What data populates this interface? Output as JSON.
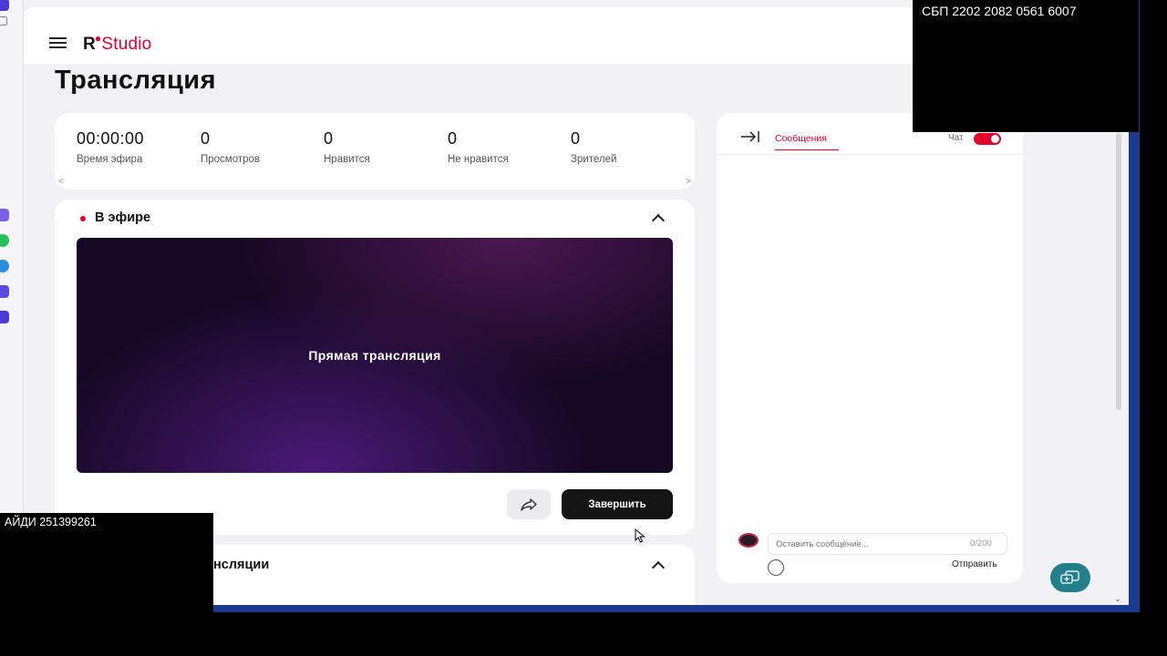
{
  "brand": {
    "r": "R",
    "studio": "Studio"
  },
  "page": {
    "title": "Трансляция"
  },
  "stats": [
    {
      "value": "00:00:00",
      "label": "Время эфира"
    },
    {
      "value": "0",
      "label": "Просмотров"
    },
    {
      "value": "0",
      "label": "Нравится"
    },
    {
      "value": "0",
      "label": "Не нравится"
    },
    {
      "value": "0",
      "label": "Зрителей"
    }
  ],
  "stats_scroll": {
    "left": "<",
    "right": ">"
  },
  "live": {
    "title": "В эфире",
    "video_label": "Прямая трансляция",
    "end_label": "Завершить"
  },
  "info_section": {
    "title": "нсляции"
  },
  "chat": {
    "tab_messages": "Сообщения",
    "toggle_label": "Чат",
    "toggle_on": true,
    "input_placeholder": "Оставить сообщение...",
    "counter": "0/200",
    "send_label": "Отправить"
  },
  "overlays": {
    "top_right": "СБП 2202 2082 0561 6007",
    "bottom_left": "АЙДИ 251399261"
  },
  "colors": {
    "accent": "#e4002b",
    "fab": "#23808a",
    "end_button": "#141414"
  },
  "icons": {
    "menu": "hamburger-icon",
    "share": "share-icon",
    "collapse": "collapse-panel-icon",
    "emoji": "emoji-icon",
    "fab": "chat-support-icon"
  }
}
